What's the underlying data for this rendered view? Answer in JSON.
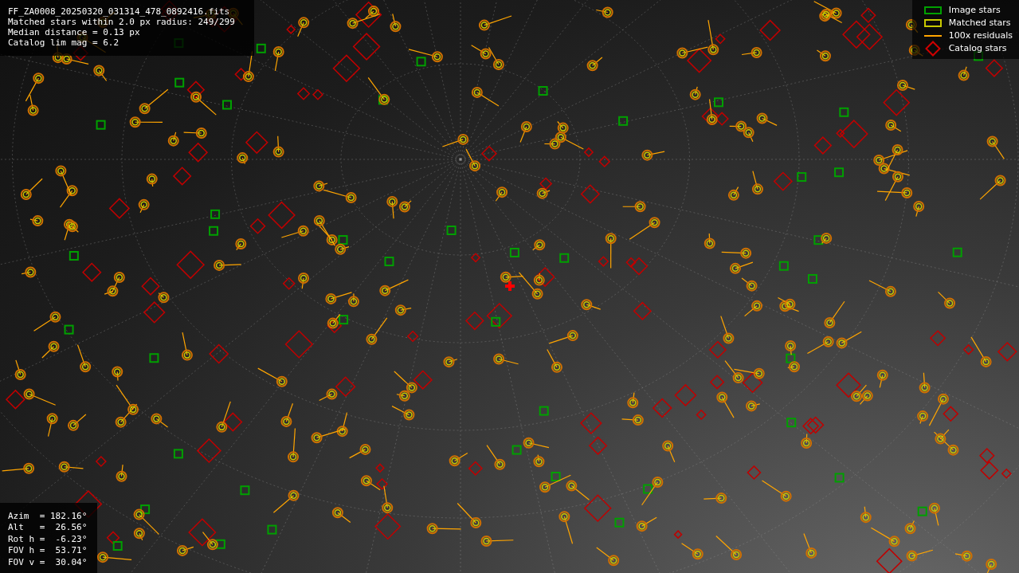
{
  "info_box": {
    "lines": [
      "FF_ZA0008_20250320_031314_478_0892416.fits",
      "Matched stars within 2.0 px radius: 249/299",
      "Median distance = 0.13 px",
      "Catalog lim mag = 6.2"
    ]
  },
  "legend": {
    "items": [
      {
        "kind": "box",
        "color": "#00a000",
        "label": "Image stars"
      },
      {
        "kind": "box",
        "color": "#c8c800",
        "label": "Matched stars"
      },
      {
        "kind": "line",
        "color": "#ffa500",
        "label": "100x residuals"
      },
      {
        "kind": "diamond",
        "color": "#d00000",
        "label": "Catalog stars"
      }
    ]
  },
  "pointing_box": {
    "lines": [
      "Azim  = 182.16°",
      "Alt   =  26.56°",
      "Rot h =  -6.23°",
      "FOV h =  53.71°",
      "FOV v =  30.04°"
    ]
  }
}
